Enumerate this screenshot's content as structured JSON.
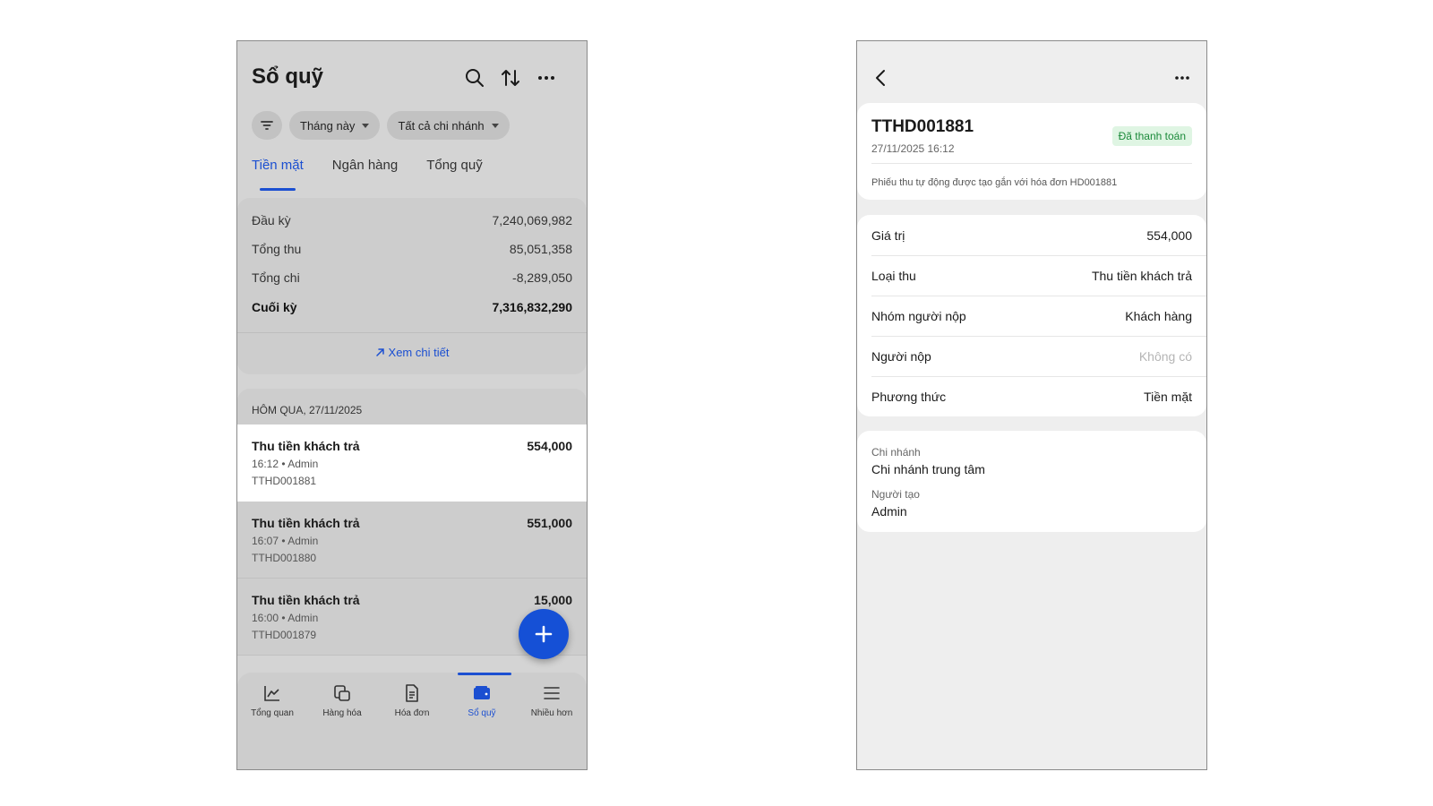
{
  "left": {
    "title": "Sổ quỹ",
    "icons": [
      "search-icon",
      "sort-icon",
      "more-icon"
    ],
    "filters": {
      "period": "Tháng này",
      "branch": "Tất cả chi nhánh"
    },
    "tabs": [
      "Tiền mặt",
      "Ngân hàng",
      "Tổng quỹ"
    ],
    "active_tab": 0,
    "summary": {
      "opening_label": "Đầu kỳ",
      "opening_value": "7,240,069,982",
      "income_label": "Tổng thu",
      "income_value": "85,051,358",
      "expense_label": "Tổng chi",
      "expense_value": "-8,289,050",
      "closing_label": "Cuối kỳ",
      "closing_value": "7,316,832,290",
      "detail_link": "Xem chi tiết"
    },
    "day_header": "HÔM QUA, 27/11/2025",
    "transactions": [
      {
        "title": "Thu tiền khách trả",
        "amount": "554,000",
        "meta": "16:12 • Admin",
        "code": "TTHD001881"
      },
      {
        "title": "Thu tiền khách trả",
        "amount": "551,000",
        "meta": "16:07 • Admin",
        "code": "TTHD001880"
      },
      {
        "title": "Thu tiền khách trả",
        "amount": "15,000",
        "meta": "16:00 • Admin",
        "code": "TTHD001879"
      }
    ],
    "nav": [
      {
        "label": "Tổng quan",
        "icon": "chart-icon"
      },
      {
        "label": "Hàng hóa",
        "icon": "products-icon"
      },
      {
        "label": "Hóa đơn",
        "icon": "invoice-icon"
      },
      {
        "label": "Sổ quỹ",
        "icon": "wallet-icon"
      },
      {
        "label": "Nhiều hơn",
        "icon": "menu-icon"
      }
    ],
    "accent": "#1b4fd1"
  },
  "right": {
    "code": "TTHD001881",
    "date": "27/11/2025 16:12",
    "status": "Đã thanh toán",
    "note": "Phiếu thu tự động được tạo gắn với hóa đơn HD001881",
    "rows": [
      {
        "label": "Giá trị",
        "value": "554,000"
      },
      {
        "label": "Loại thu",
        "value": "Thu tiền khách trả"
      },
      {
        "label": "Nhóm người nộp",
        "value": "Khách hàng"
      },
      {
        "label": "Người nộp",
        "value": "Không có"
      },
      {
        "label": "Phương thức",
        "value": "Tiền mặt"
      }
    ],
    "branch_label": "Chi nhánh",
    "branch_value": "Chi nhánh trung tâm",
    "creator_label": "Người tạo",
    "creator_value": "Admin",
    "status_color": "#1b8a3a"
  }
}
